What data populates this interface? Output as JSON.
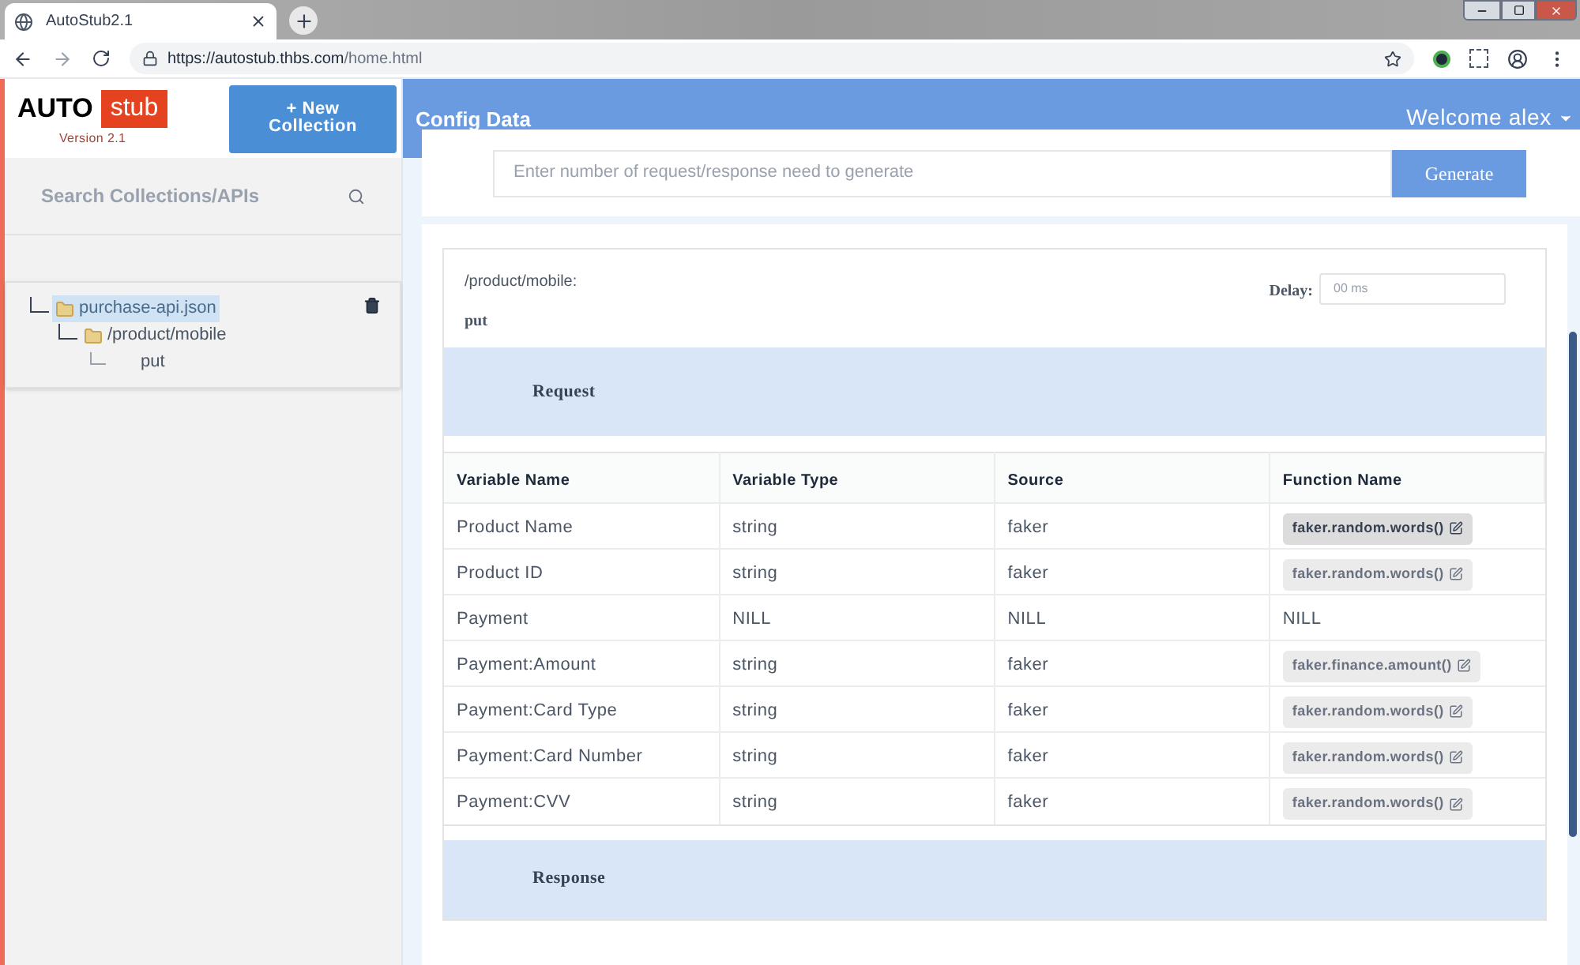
{
  "browser": {
    "tab_title": "AutoStub2.1",
    "url_host": "https://autostub.thbs.com",
    "url_path": "/home.html"
  },
  "sidebar": {
    "logo_left": "AUTO",
    "logo_right": "stub",
    "version": "Version 2.1",
    "new_button": "+ New Collection",
    "search_placeholder": "Search Collections/APIs",
    "tree": [
      {
        "label": "purchase-api.json",
        "selected": true,
        "children": [
          {
            "label": "/product/mobile",
            "selected": false,
            "children": [
              {
                "label": "put",
                "selected": false
              }
            ]
          }
        ]
      }
    ]
  },
  "header": {
    "title": "Config Data",
    "user": "Welcome alex"
  },
  "generate": {
    "placeholder": "Enter number of request/response need to generate",
    "button": "Generate"
  },
  "config": {
    "path": "/product/mobile:",
    "method": "put",
    "delay_label": "Delay:",
    "delay_placeholder": "00 ms",
    "request_title": "Request",
    "response_title": "Response",
    "columns": [
      "Variable Name",
      "Variable Type",
      "Source",
      "Function Name"
    ],
    "rows": [
      {
        "name": "Product Name",
        "type": "string",
        "source": "faker",
        "function": {
          "kind": "chip",
          "text": "faker.random.words()",
          "hovered": true
        }
      },
      {
        "name": "Product ID",
        "type": "string",
        "source": "faker",
        "function": {
          "kind": "chip",
          "text": "faker.random.words()",
          "hovered": false
        }
      },
      {
        "name": "Payment",
        "type": "NILL",
        "source": "NILL",
        "function": {
          "kind": "text",
          "text": "NILL"
        }
      },
      {
        "name": "Payment:Amount",
        "type": "string",
        "source": "faker",
        "function": {
          "kind": "chip",
          "text": "faker.finance.amount()",
          "hovered": false
        }
      },
      {
        "name": "Payment:Card Type",
        "type": "string",
        "source": "faker",
        "function": {
          "kind": "chip",
          "text": "faker.random.words()",
          "hovered": false
        }
      },
      {
        "name": "Payment:Card Number",
        "type": "string",
        "source": "faker",
        "function": {
          "kind": "chip",
          "text": "faker.random.words()",
          "hovered": false
        }
      },
      {
        "name": "Payment:CVV",
        "type": "string",
        "source": "faker",
        "function": {
          "kind": "chip",
          "text": "faker.random.words()",
          "hovered": false
        }
      }
    ]
  }
}
